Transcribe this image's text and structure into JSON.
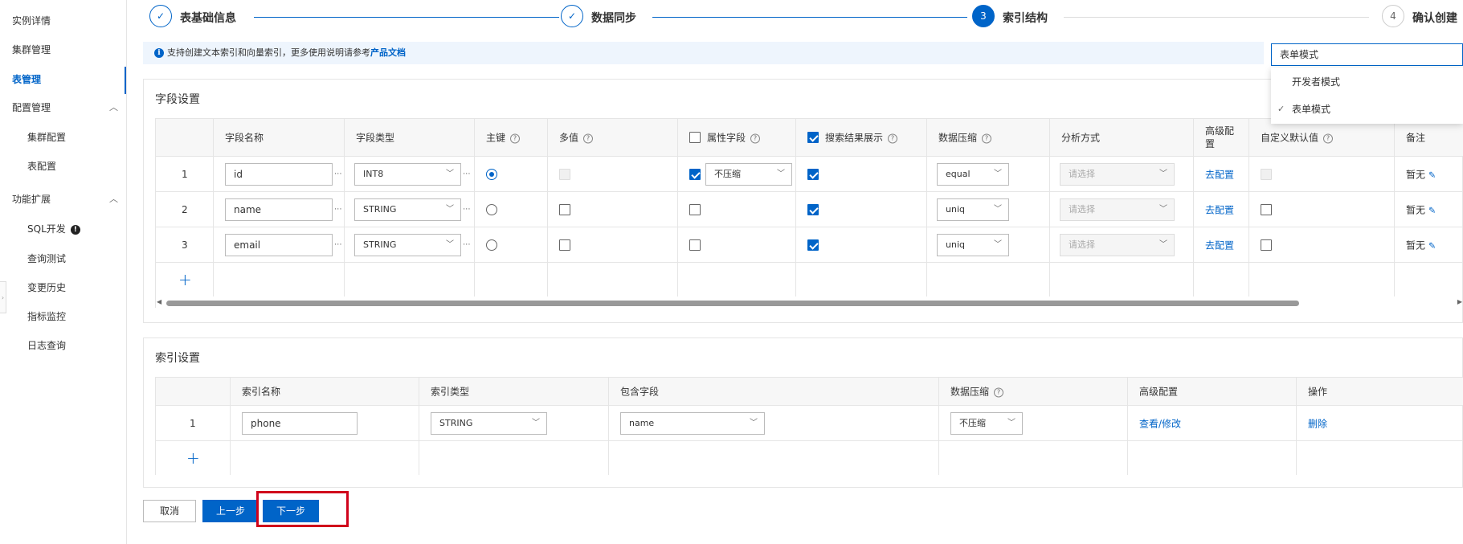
{
  "sidebar": {
    "items": [
      {
        "label": "实例详情"
      },
      {
        "label": "集群管理"
      },
      {
        "label": "表管理"
      }
    ],
    "groups": [
      {
        "label": "配置管理",
        "children": [
          "集群配置",
          "表配置"
        ]
      },
      {
        "label": "功能扩展",
        "children": [
          "SQL开发",
          "查询测试",
          "变更历史",
          "指标监控",
          "日志查询"
        ]
      }
    ],
    "warn_glyph": "!",
    "active_color": "#0064c8"
  },
  "steps": [
    {
      "label": "表基础信息",
      "state": "done"
    },
    {
      "label": "数据同步",
      "state": "done"
    },
    {
      "label": "索引结构",
      "state": "current",
      "number": "3"
    },
    {
      "label": "确认创建",
      "state": "pending",
      "number": "4"
    }
  ],
  "info": {
    "text": "支持创建文本索引和向量索引，更多使用说明请参考",
    "link": "产品文档",
    "icon": "info-icon"
  },
  "mode": {
    "selected": "表单模式",
    "options": [
      {
        "label": "开发者模式",
        "checked": false
      },
      {
        "label": "表单模式",
        "checked": true
      }
    ]
  },
  "fields": {
    "title": "字段设置",
    "headers": {
      "name": "字段名称",
      "type": "字段类型",
      "pk": "主键",
      "multi": "多值",
      "attr": "属性字段",
      "search": "搜索结果展示",
      "compress": "数据压缩",
      "analyzer": "分析方式",
      "advanced": "高级配",
      "advanced2": "置",
      "default": "自定义默认值",
      "remark": "备注"
    },
    "rows": [
      {
        "index": "1",
        "name": "id",
        "type": "INT8",
        "pk": true,
        "multi_disabled": true,
        "attr": true,
        "attr_compress": "不压缩",
        "search": true,
        "compress": "equal",
        "analyzer": "请选择",
        "advanced": "去配置",
        "default_disabled": true,
        "remark": "暂无"
      },
      {
        "index": "2",
        "name": "name",
        "type": "STRING",
        "pk": false,
        "multi_disabled": false,
        "attr": false,
        "attr_compress": "",
        "search": true,
        "compress": "uniq",
        "analyzer": "请选择",
        "advanced": "去配置",
        "default_disabled": false,
        "remark": "暂无"
      },
      {
        "index": "3",
        "name": "email",
        "type": "STRING",
        "pk": false,
        "multi_disabled": false,
        "attr": false,
        "attr_compress": "",
        "search": true,
        "compress": "uniq",
        "analyzer": "请选择",
        "advanced": "去配置",
        "default_disabled": false,
        "remark": "暂无"
      }
    ],
    "add": "+"
  },
  "indexes": {
    "title": "索引设置",
    "headers": {
      "name": "索引名称",
      "type": "索引类型",
      "fields": "包含字段",
      "compress": "数据压缩",
      "advanced": "高级配置",
      "action": "操作"
    },
    "rows": [
      {
        "index": "1",
        "name": "phone",
        "type": "STRING",
        "fields": "name",
        "compress": "不压缩",
        "advanced": "查看/修改",
        "action": "删除"
      }
    ],
    "add": "+"
  },
  "buttons": {
    "cancel": "取消",
    "prev": "上一步",
    "next": "下一步"
  },
  "glyphs": {
    "check": "✓",
    "help": "?",
    "caret": "﹀",
    "chevron_up": "︿",
    "dots": "···",
    "pencil": "✎",
    "collapse": "›",
    "scroll_left": "◀",
    "scroll_right": "▶"
  },
  "colors": {
    "accent": "#0064c8",
    "highlight": "#d0021b",
    "info_bg": "#eef5fd"
  }
}
